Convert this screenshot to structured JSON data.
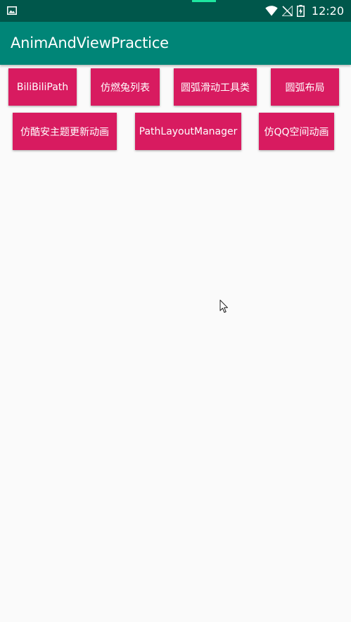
{
  "status_bar": {
    "time": "12:20",
    "icons": [
      "image-notification-icon",
      "wifi-icon",
      "no-signal-icon",
      "battery-charging-icon"
    ]
  },
  "app_bar": {
    "title": "AnimAndViewPractice"
  },
  "buttons": [
    {
      "label": "BiliBiliPath"
    },
    {
      "label": "仿燃兔列表"
    },
    {
      "label": "圆弧滑动工具类"
    },
    {
      "label": "圆弧布局"
    },
    {
      "label": "仿酷安主题更新动画"
    },
    {
      "label": "PathLayoutManager"
    },
    {
      "label": "仿QQ空间动画"
    }
  ],
  "colors": {
    "status_bar": "#00574b",
    "app_bar": "#008577",
    "button": "#d81b60",
    "background": "#fafafa"
  }
}
